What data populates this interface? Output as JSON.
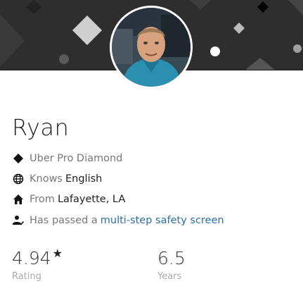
{
  "profile": {
    "name": "Ryan",
    "avatar_alt": "Driver profile photo"
  },
  "details": {
    "tier": {
      "icon": "diamond-icon",
      "text": "Uber Pro Diamond"
    },
    "language": {
      "icon": "globe-icon",
      "prefix": "Knows",
      "value": "English"
    },
    "hometown": {
      "icon": "home-icon",
      "prefix": "From",
      "value": "Lafayette, LA"
    },
    "safety": {
      "icon": "verified-user-icon",
      "prefix": "Has passed a",
      "link": "multi-step safety screen"
    }
  },
  "stats": {
    "rating": {
      "value": "4.94",
      "star": "★",
      "label": "Rating"
    },
    "years": {
      "value": "6.5",
      "label": "Years"
    }
  },
  "colors": {
    "banner": "#2e2e2e",
    "link": "#2c6fa6",
    "muted": "#777777"
  }
}
